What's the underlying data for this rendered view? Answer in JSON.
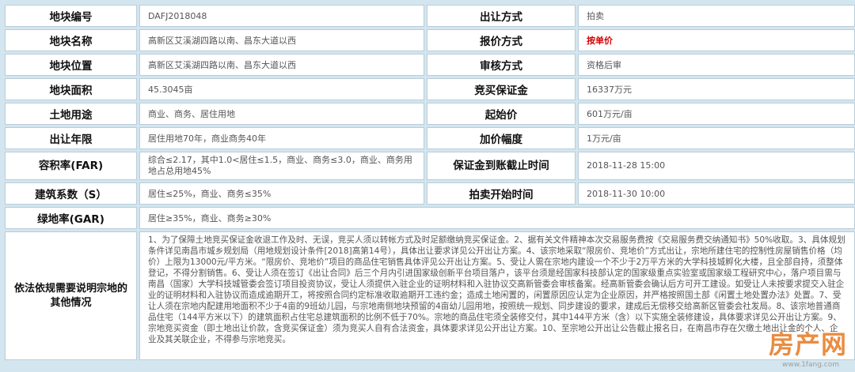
{
  "rows": [
    {
      "l1": "地块编号",
      "v1": "DAFJ2018048",
      "l2": "出让方式",
      "v2": "拍卖"
    },
    {
      "l1": "地块名称",
      "v1": "高新区艾溪湖四路以南、昌东大道以西",
      "l2": "报价方式",
      "v2": "按单价"
    },
    {
      "l1": "地块位置",
      "v1": "高新区艾溪湖四路以南、昌东大道以西",
      "l2": "审核方式",
      "v2": "资格后审"
    },
    {
      "l1": "地块面积",
      "v1": "45.3045亩",
      "l2": "竞买保证金",
      "v2": "16337万元"
    },
    {
      "l1": "土地用途",
      "v1": "商业、商务、居住用地",
      "l2": "起始价",
      "v2": "601万元/亩"
    },
    {
      "l1": "出让年限",
      "v1": "居住用地70年，商业商务40年",
      "l2": "加价幅度",
      "v2": "1万元/亩"
    },
    {
      "l1": "容积率(FAR)",
      "v1": "综合≤2.17，其中1.0<居住≤1.5，商业、商务≤3.0，商业、商务用地占总用地45%",
      "l2": "保证金到账截止时间",
      "v2": "2018-11-28 15:00"
    },
    {
      "l1": "建筑系数（S）",
      "v1": "居住≤25%，商业、商务≤35%",
      "l2": "拍卖开始时间",
      "v2": "2018-11-30 10:00"
    },
    {
      "l1": "绿地率(GAR)",
      "v1": "居住≥35%，商业、商务≥30%"
    }
  ],
  "notes_label": "依法依规需要说明宗地的其他情况",
  "notes": "1、为了保障土地竞买保证金收退工作及时、无误，竞买人须以转帐方式及时足额缴纳竞买保证金。2、据有关文件精神本次交易服务费按《交易服务费交纳通知书》50%收取。3、具体规划条件详见南昌市城乡规划局（用地规划设计条件[2018]高第14号），具体出让要求详见公开出让方案。4、该宗地采取“限房价、竞地价”方式出让，宗地所建住宅的控制性房屋销售价格（均价）上限为13000元/平方米。“限房价、竞地价”项目的商品住宅销售具体评见公开出让方案。5、受让人需在宗地内建设一个不少于2万平方米的大学科技城孵化大楼，且全部自持，须整体登记，不得分割销售。6、受让人须在签订《出让合同》后三个月内引进国家级创新平台项目落户，该平台须是经国家科技部认定的国家级重点实验室或国家级工程研究中心，落户项目需与南昌（国家）大学科技城管委会签订项目投资协议，受让人须提供入驻企业的证明材料和入驻协议交高新管委会审核备案。经高新管委会确认后方可开工建设。如受让人未按要求提交入驻企业的证明材料和入驻协议而造成逾期开工，将按照合同约定标准收取逾期开工违约金；造成土地闲置的，闲置原因应认定为企业原因，并严格按照国土部《闲置土地处置办法》处置。7、受让人须在宗地内配建用地面积不少于4亩的9班幼儿园，与宗地南侧地块预留的4亩幼儿园用地，按照统一规划、同步建设的要求，建成后无偿移交给高新区管委会社发局。8、该宗地普通商品住宅（144平方米以下）的建筑面积占住宅总建筑面积的比例不低于70%。宗地的商品住宅须全装修交付，其中144平方米（含）以下实施全装修建设，具体要求详见公开出让方案。9、宗地竞买资金（即土地出让价款，含竞买保证金）须为竞买人自有合法资金，具体要求详见公开出让方案。10、至宗地公开出让公告截止报名日，在南昌市存在欠缴土地出让金的个人、企业及其关联企业，不得参与宗地竞买。",
  "watermark": {
    "text": "房产网",
    "url": "www.1fang.com"
  }
}
